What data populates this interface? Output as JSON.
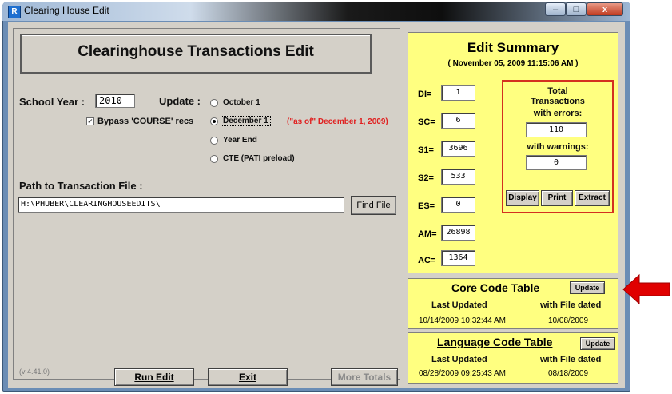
{
  "window": {
    "title": "Clearing House Edit",
    "app_icon": "R",
    "min": "–",
    "max": "□",
    "close": "x"
  },
  "header": {
    "title": "Clearinghouse  Transactions  Edit"
  },
  "form": {
    "school_year_label": "School Year :",
    "school_year_value": "2010",
    "update_label": "Update :",
    "bypass_label": "Bypass 'COURSE' recs",
    "bypass_checked": true,
    "radio_options": [
      "October 1",
      "December 1",
      "Year End",
      "CTE (PATI preload)"
    ],
    "selected_option": "December 1",
    "as_of_note": "(\"as of\"  December 1, 2009)",
    "path_label": "Path to Transaction File :",
    "path_value": "H:\\PHUBER\\CLEARINGHOUSEEDITS\\",
    "find_file_label": "Find File"
  },
  "footer": {
    "version": "(v 4.41.0)",
    "run_edit_label": "Run Edit",
    "exit_label": "Exit",
    "more_totals_label": "More Totals"
  },
  "summary": {
    "title": "Edit  Summary",
    "date": "( November 05, 2009  11:15:06 AM )",
    "codes": [
      {
        "label": "DI=",
        "value": "1"
      },
      {
        "label": "SC=",
        "value": "6"
      },
      {
        "label": "S1=",
        "value": "3696"
      },
      {
        "label": "S2=",
        "value": "533"
      },
      {
        "label": "ES=",
        "value": "0"
      },
      {
        "label": "AM=",
        "value": "26898"
      },
      {
        "label": "AC=",
        "value": "1364"
      }
    ],
    "totals": {
      "heading_line1": "Total",
      "heading_line2": "Transactions",
      "errors_label": "with errors:",
      "errors_value": "110",
      "warnings_label": "with warnings:",
      "warnings_value": "0",
      "display_label": "Display",
      "print_label": "Print",
      "extract_label": "Extract"
    }
  },
  "core_table": {
    "title": "Core Code Table",
    "update_label": "Update",
    "last_updated_label": "Last Updated",
    "file_dated_label": "with File dated",
    "last_updated": "10/14/2009  10:32:44 AM",
    "file_dated": "10/08/2009"
  },
  "language_table": {
    "title": "Language Code Table",
    "update_label": "Update",
    "last_updated_label": "Last Updated",
    "file_dated_label": "with File dated",
    "last_updated": "08/28/2009  09:25:43 AM",
    "file_dated": "08/18/2009"
  },
  "colors": {
    "panel_yellow": "#ffff80",
    "accent_red": "#d43020",
    "arrow_red": "#e00000",
    "face": "#d4d0c8"
  }
}
